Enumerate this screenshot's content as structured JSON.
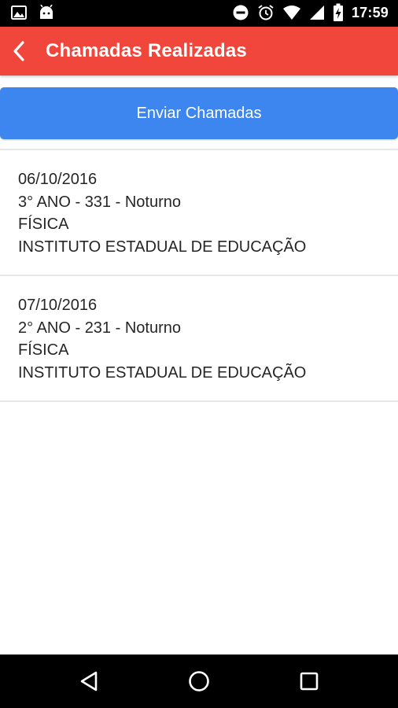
{
  "status_bar": {
    "time": "17:59",
    "left_icons": [
      "image-icon",
      "android-icon"
    ],
    "right_icons": [
      "do-not-disturb-icon",
      "alarm-icon",
      "wifi-icon",
      "signal-icon",
      "battery-charging-icon"
    ]
  },
  "app_bar": {
    "title": "Chamadas Realizadas",
    "background_color": "#f0463c"
  },
  "send_button": {
    "label": "Enviar Chamadas",
    "background_color": "#3d85ef"
  },
  "calls": [
    {
      "date": "06/10/2016",
      "class": "3° ANO - 331 - Noturno",
      "subject": "FÍSICA",
      "school": "INSTITUTO ESTADUAL DE EDUCAÇÃO"
    },
    {
      "date": "07/10/2016",
      "class": "2° ANO - 231 - Noturno",
      "subject": "FÍSICA",
      "school": "INSTITUTO ESTADUAL DE EDUCAÇÃO"
    }
  ],
  "nav_bar": {
    "buttons": [
      "back-triangle-icon",
      "home-circle-icon",
      "recents-square-icon"
    ]
  }
}
